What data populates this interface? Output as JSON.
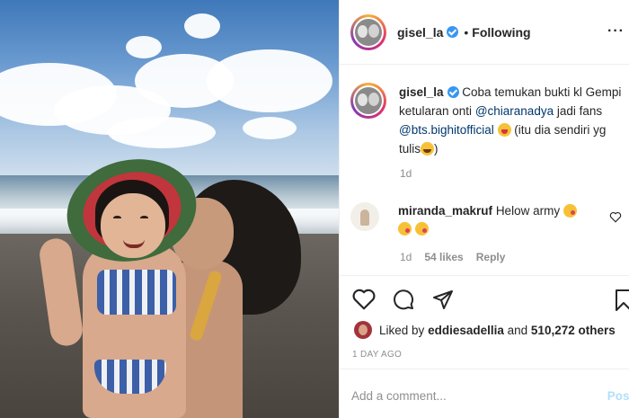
{
  "header": {
    "username": "gisel_la",
    "separator": "•",
    "follow_status": "Following",
    "more_label": "···"
  },
  "caption": {
    "username": "gisel_la",
    "text_before_mention1": "Coba temukan bukti kl Gempi ketularan onti",
    "mention1": "@chiaranadya",
    "text_between": "jadi fans",
    "mention2": "@bts.bighitofficial",
    "text_after": "(itu dia sendiri yg tulis",
    "text_close": ")",
    "time": "1d"
  },
  "comment": {
    "username": "miranda_makruf",
    "text": "Helow army",
    "time": "1d",
    "likes": "54 likes",
    "reply_label": "Reply"
  },
  "likes": {
    "prefix": "Liked by",
    "user": "eddiesadellia",
    "joiner": "and",
    "count": "510,272 others"
  },
  "post_time": "1 DAY AGO",
  "add_comment": {
    "placeholder": "Add a comment...",
    "post_label": "Post"
  },
  "icons": {
    "like": "heart-icon",
    "comment": "comment-icon",
    "share": "share-icon",
    "save": "bookmark-icon"
  },
  "colors": {
    "link": "#00376b",
    "verified": "#3897f0",
    "muted": "#8e8e8e",
    "post_button": "#b2dffc"
  }
}
